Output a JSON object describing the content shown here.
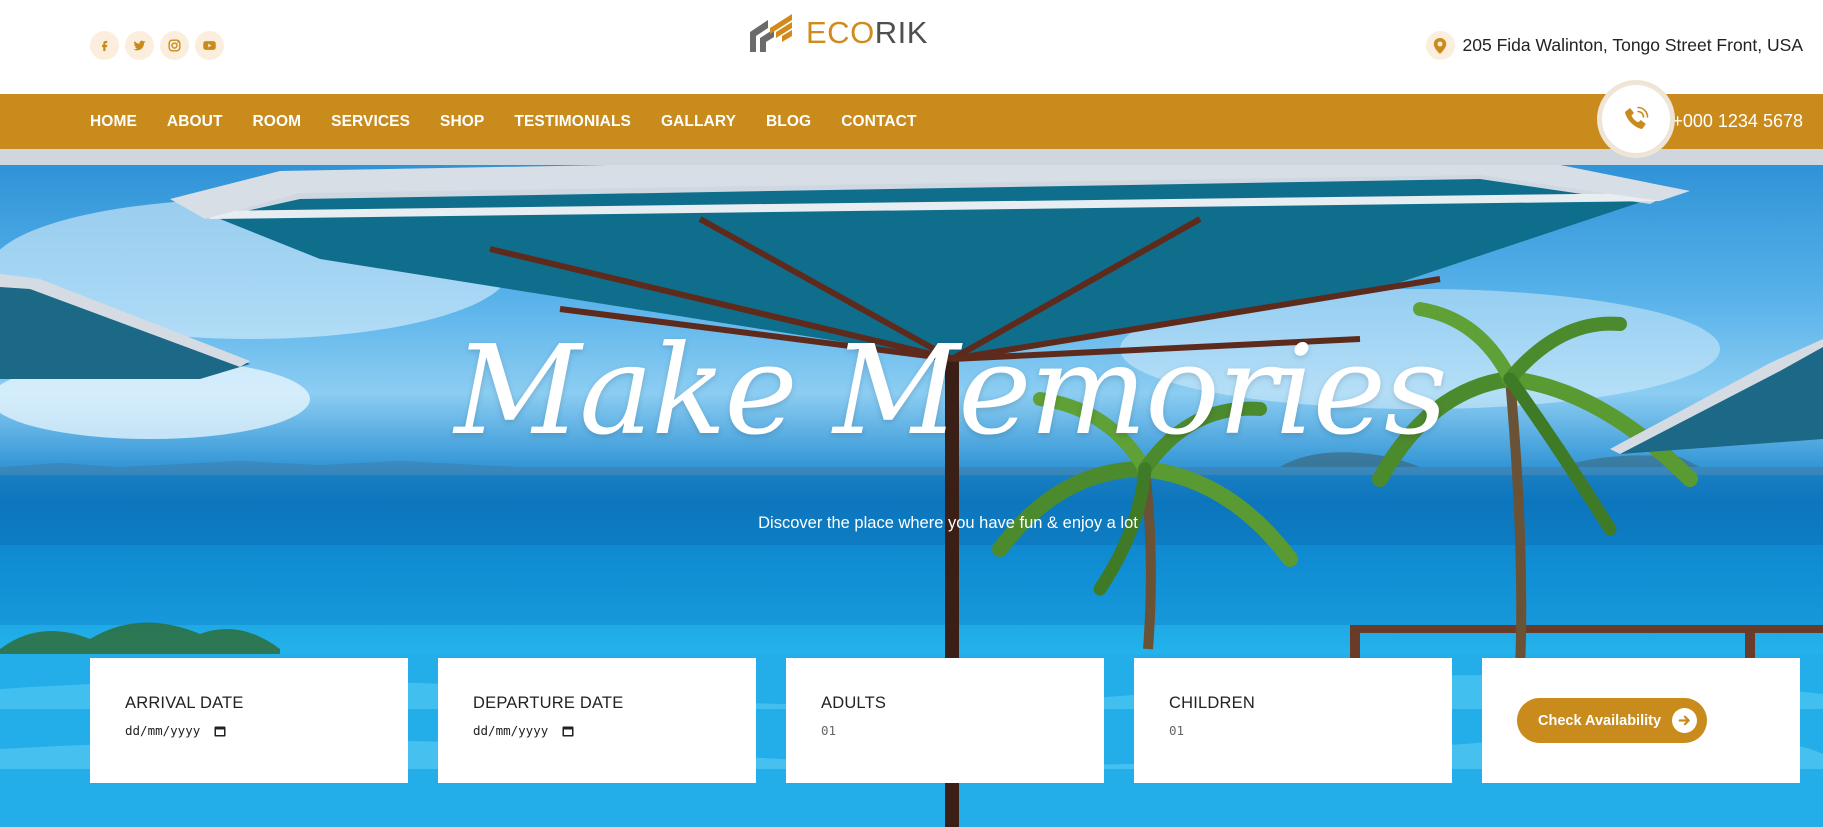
{
  "socials": [
    {
      "icon": "facebook-icon"
    },
    {
      "icon": "twitter-icon"
    },
    {
      "icon": "instagram-icon"
    },
    {
      "icon": "youtube-icon"
    }
  ],
  "logo": {
    "part1": "ECO",
    "part2": "RIK"
  },
  "address": {
    "icon": "location-pin-icon",
    "text": "205 Fida Walinton, Tongo Street Front, USA"
  },
  "nav": {
    "items": [
      "HOME",
      "ABOUT",
      "ROOM",
      "SERVICES",
      "SHOP",
      "TESTIMONIALS",
      "GALLARY",
      "BLOG",
      "CONTACT"
    ]
  },
  "phone": {
    "icon": "phone-icon",
    "number": "+000 1234 5678"
  },
  "hero": {
    "title": "Make Memories",
    "subtitle": "Discover the place where you have fun & enjoy a lot"
  },
  "booking": {
    "arrival": {
      "label": "ARRIVAL DATE",
      "placeholder": "dd/mm/yyyy"
    },
    "departure": {
      "label": "DEPARTURE DATE",
      "placeholder": "dd/mm/yyyy"
    },
    "adults": {
      "label": "ADULTS",
      "value": "01"
    },
    "children": {
      "label": "CHILDREN",
      "value": "01"
    },
    "button": "Check Availability"
  },
  "colors": {
    "accent": "#c98b1b",
    "accent_light": "#fbeedd",
    "text_dark": "#222222",
    "logo_gray": "#4f4f4f"
  }
}
